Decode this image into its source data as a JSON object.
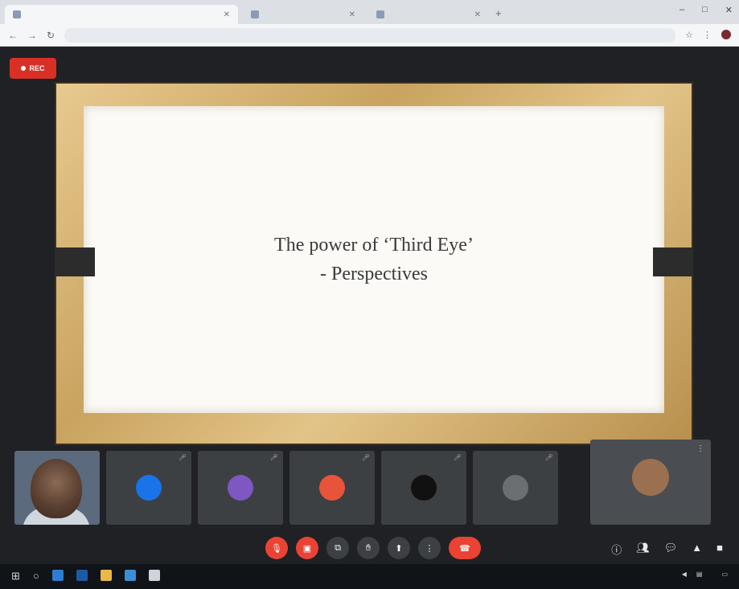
{
  "browser": {
    "tabs": [
      {
        "title": "",
        "active": true
      },
      {
        "title": "",
        "active": false
      },
      {
        "title": "",
        "active": false
      }
    ],
    "url": "",
    "window_controls": [
      "–",
      "□",
      "✕"
    ]
  },
  "meet": {
    "rec_label": "REC",
    "slide": {
      "title_line1": "The power of ‘Third Eye’",
      "title_line2": "- Perspectives"
    },
    "participants": [
      {
        "name": "",
        "avatar_color": "#1a73e8"
      },
      {
        "name": "",
        "avatar_color": "#7e57c2"
      },
      {
        "name": "",
        "avatar_color": "#e8543a"
      },
      {
        "name": "",
        "avatar_color": "#111111"
      },
      {
        "name": "",
        "avatar_color": "#6b6f72"
      },
      {
        "name": "",
        "avatar_color": "#9a7050"
      }
    ],
    "meeting_info": "",
    "colors": {
      "accent_red": "#ea4335",
      "tile": "#3c4043"
    }
  },
  "taskbar": {
    "clock": ""
  }
}
